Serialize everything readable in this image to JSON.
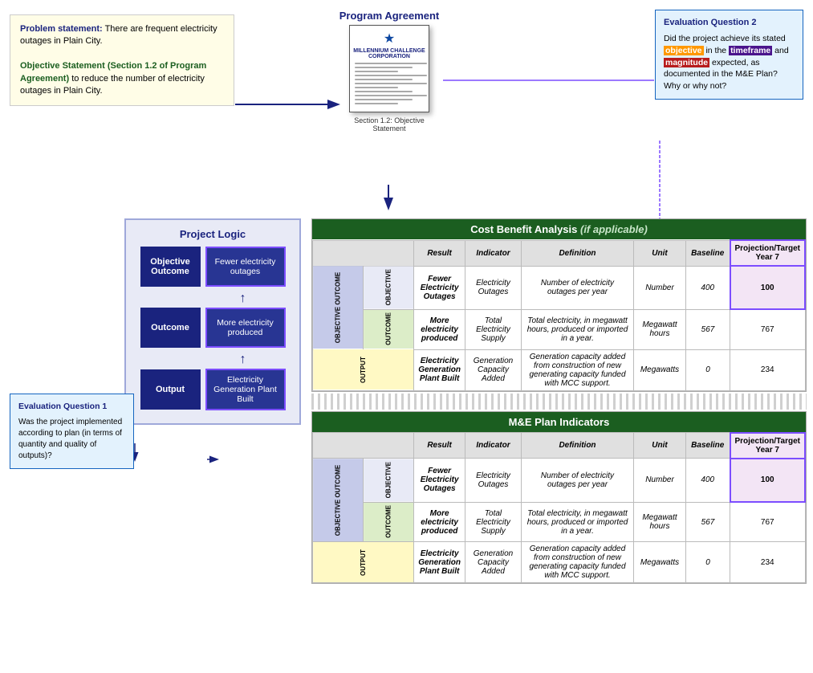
{
  "problemBox": {
    "boldLabel": "Problem statement:",
    "text": " There are frequent electricity outages in Plain City.",
    "objectiveLabel": "Objective Statement (Section 1.2 of Program Agreement)",
    "objectiveText": " to reduce the number of electricity outages in Plain City."
  },
  "doc": {
    "title": "Program Agreement",
    "orgName": "MILLENNIUM CHALLENGE CORPORATION",
    "sectionLabel": "Section 1.2: Objective Statement"
  },
  "eq2": {
    "title": "Evaluation Question 2",
    "highlightObjective": "objective",
    "highlightTimeframe": "timeframe",
    "highlightMagnitude": "magnitude"
  },
  "projectLogic": {
    "title": "Project Logic",
    "rows": [
      {
        "label": "Objective Outcome",
        "result": "Fewer electricity outages"
      },
      {
        "label": "Outcome",
        "result": "More electricity produced"
      },
      {
        "label": "Output",
        "result": "Electricity Generation Plant Built"
      }
    ]
  },
  "eq1": {
    "title": "Evaluation Question 1",
    "text": "Was the project implemented according to plan (in terms of quantity and quality of outputs)?"
  },
  "cba": {
    "title": "Cost Benefit Analysis ",
    "subtitle": "(if applicable)",
    "columns": [
      "Result",
      "Indicator",
      "Definition",
      "Unit",
      "Baseline",
      "Projection/Target",
      "Year 7"
    ],
    "rows": [
      {
        "sectionLabel": "OBJECTIVE OUTCOME",
        "subLabel": "OBJECTIVE",
        "result": "Fewer Electricity Outages",
        "indicator": "Electricity Outages",
        "definition": "Number of electricity outages per year",
        "unit": "Number",
        "baseline": "400",
        "projection": "100"
      },
      {
        "subLabel": "OUTCOME",
        "result": "More electricity produced",
        "indicator": "Total Electricity Supply",
        "definition": "Total electricity, in megawatt hours, produced or imported in a year.",
        "unit": "Megawatt hours",
        "baseline": "567",
        "projection": "767"
      },
      {
        "sectionLabel": "OUTPUT",
        "result": "Electricity Generation Plant Built",
        "indicator": "Generation Capacity Added",
        "definition": "Generation capacity added from construction of new generating capacity funded with MCC support.",
        "unit": "Megawatts",
        "baseline": "0",
        "projection": "234"
      }
    ]
  },
  "mePlan": {
    "title": "M&E Plan Indicators",
    "columns": [
      "Result",
      "Indicator",
      "Definition",
      "Unit",
      "Baseline",
      "Projection/Target",
      "Year 7"
    ],
    "rows": [
      {
        "sectionLabel": "OBJECTIVE OUTCOME",
        "subLabel": "OBJECTIVE",
        "result": "Fewer Electricity Outages",
        "indicator": "Electricity Outages",
        "definition": "Number of electricity outages per year",
        "unit": "Number",
        "baseline": "400",
        "projection": "100"
      },
      {
        "subLabel": "OUTCOME",
        "result": "More electricity produced",
        "indicator": "Total Electricity Supply",
        "definition": "Total electricity, in megawatt hours, produced or imported in a year.",
        "unit": "Megawatt hours",
        "baseline": "567",
        "projection": "767"
      },
      {
        "sectionLabel": "OUTPUT",
        "result": "Electricity Generation Plant Built",
        "indicator": "Generation Capacity Added",
        "definition": "Generation capacity added from construction of new generating capacity funded with MCC support.",
        "unit": "Megawatts",
        "baseline": "0",
        "projection": "234"
      }
    ]
  }
}
